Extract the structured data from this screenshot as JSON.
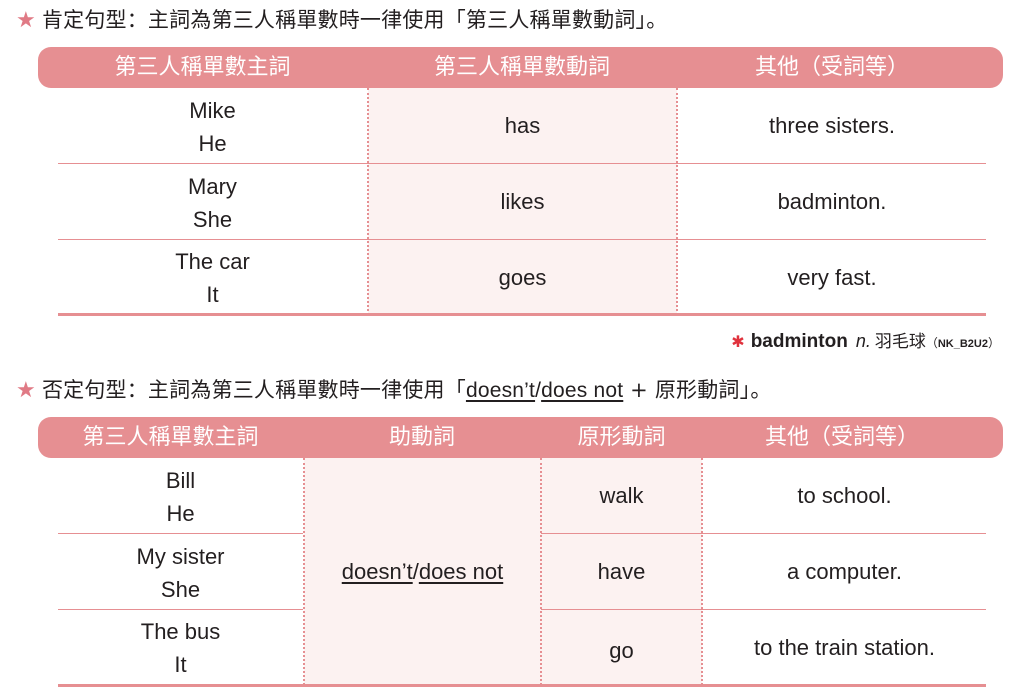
{
  "section1": {
    "title": "肯定句型：主詞為第三人稱單數時一律使用「第三人稱單數動詞」。",
    "star_icon": "star",
    "headers": [
      "第三人稱單數主詞",
      "第三人稱單數動詞",
      "其他（受詞等）"
    ],
    "rows": [
      {
        "subject": [
          "Mike",
          "He"
        ],
        "verb": "has",
        "other": "three sisters."
      },
      {
        "subject": [
          "Mary",
          "She"
        ],
        "verb": "likes",
        "other": "badminton."
      },
      {
        "subject": [
          "The car",
          "It"
        ],
        "verb": "goes",
        "other": "very fast."
      }
    ]
  },
  "vocab_note": {
    "marker": "✱",
    "word": "badminton",
    "pos": "n.",
    "meaning": "羽毛球",
    "open_paren": "（",
    "code": "NK_B2U2",
    "close_paren": "）"
  },
  "section2": {
    "title_prefix": "否定句型：主詞為第三人稱單數時一律使用「",
    "title_aux_1": "doesn’t",
    "title_slash": "/",
    "title_aux_2": "does not",
    "title_suffix": " + 原形動詞」。",
    "star_icon": "star",
    "headers": [
      "第三人稱單數主詞",
      "助動詞",
      "原形動詞",
      "其他（受詞等）"
    ],
    "auxiliary_1": "doesn’t",
    "auxiliary_slash": "/",
    "auxiliary_2": "does not",
    "rows": [
      {
        "subject": [
          "Bill",
          "He"
        ],
        "verb": "walk",
        "other": "to school."
      },
      {
        "subject": [
          "My sister",
          "She"
        ],
        "verb": "have",
        "other": "a computer."
      },
      {
        "subject": [
          "The bus",
          "It"
        ],
        "verb": "go",
        "other": "to the train station."
      }
    ]
  },
  "colors": {
    "accent": "#e68f92",
    "star": "#e07a85",
    "shade": "#fcf2f1",
    "asterisk": "#e0323d",
    "text": "#231f20"
  }
}
